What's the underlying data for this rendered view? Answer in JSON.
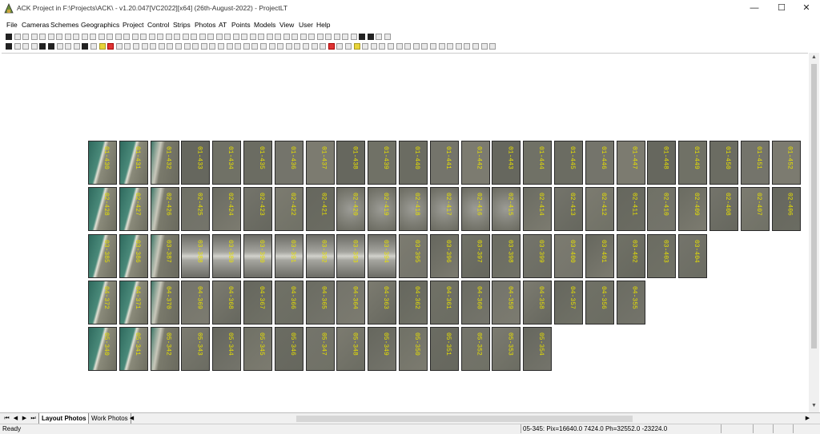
{
  "window": {
    "title": "ACK Project in F:\\Projects\\ACK\\ - v1.20.047[VC2022][x64] (26th-August-2022) - ProjectLT",
    "minimize_glyph": "—",
    "maximize_glyph": "☐",
    "close_glyph": "✕"
  },
  "menu": {
    "items": [
      "File",
      "Cameras",
      "Schemes",
      "Geographics",
      "Project",
      "Control",
      "Strips",
      "Photos",
      "AT",
      "Points",
      "Models",
      "View",
      "User",
      "Help"
    ]
  },
  "photos": {
    "strip1": [
      "01-430",
      "01-431",
      "01-432",
      "01-433",
      "01-434",
      "01-435",
      "01-436",
      "01-437",
      "01-438",
      "01-439",
      "01-440",
      "01-441",
      "01-442",
      "01-443",
      "01-444",
      "01-445",
      "01-446",
      "01-447",
      "01-448",
      "01-449",
      "01-450",
      "01-451",
      "01-452"
    ],
    "strip2": [
      "02-428",
      "02-427",
      "02-426",
      "02-425",
      "02-424",
      "02-423",
      "02-422",
      "02-421",
      "02-420",
      "02-419",
      "02-418",
      "02-417",
      "02-416",
      "02-415",
      "02-414",
      "02-413",
      "02-412",
      "02-411",
      "02-410",
      "02-409",
      "02-408",
      "02-407",
      "02-406"
    ],
    "strip3": [
      "03-385",
      "03-386",
      "03-387",
      "03-388",
      "03-389",
      "03-390",
      "03-391",
      "03-392",
      "03-393",
      "03-394",
      "03-395",
      "03-396",
      "03-397",
      "03-398",
      "03-399",
      "03-400",
      "03-401",
      "03-402",
      "03-403",
      "03-404"
    ],
    "strip4": [
      "04-372",
      "04-371",
      "04-370",
      "04-369",
      "04-368",
      "04-367",
      "04-366",
      "04-365",
      "04-364",
      "04-363",
      "04-362",
      "04-361",
      "04-360",
      "04-359",
      "04-358",
      "04-357",
      "04-356",
      "04-355"
    ],
    "strip5": [
      "05-340",
      "05-341",
      "05-342",
      "05-343",
      "05-344",
      "05-345",
      "05-346",
      "05-347",
      "05-348",
      "05-349",
      "05-350",
      "05-351",
      "05-352",
      "05-353",
      "05-354"
    ]
  },
  "tabs": {
    "layout": "Layout Photos",
    "work": "Work Photos"
  },
  "status": {
    "ready": "Ready",
    "info": "05-345: Pix=16640.0 7424.0 Ph=32552.0 -23224.0"
  }
}
